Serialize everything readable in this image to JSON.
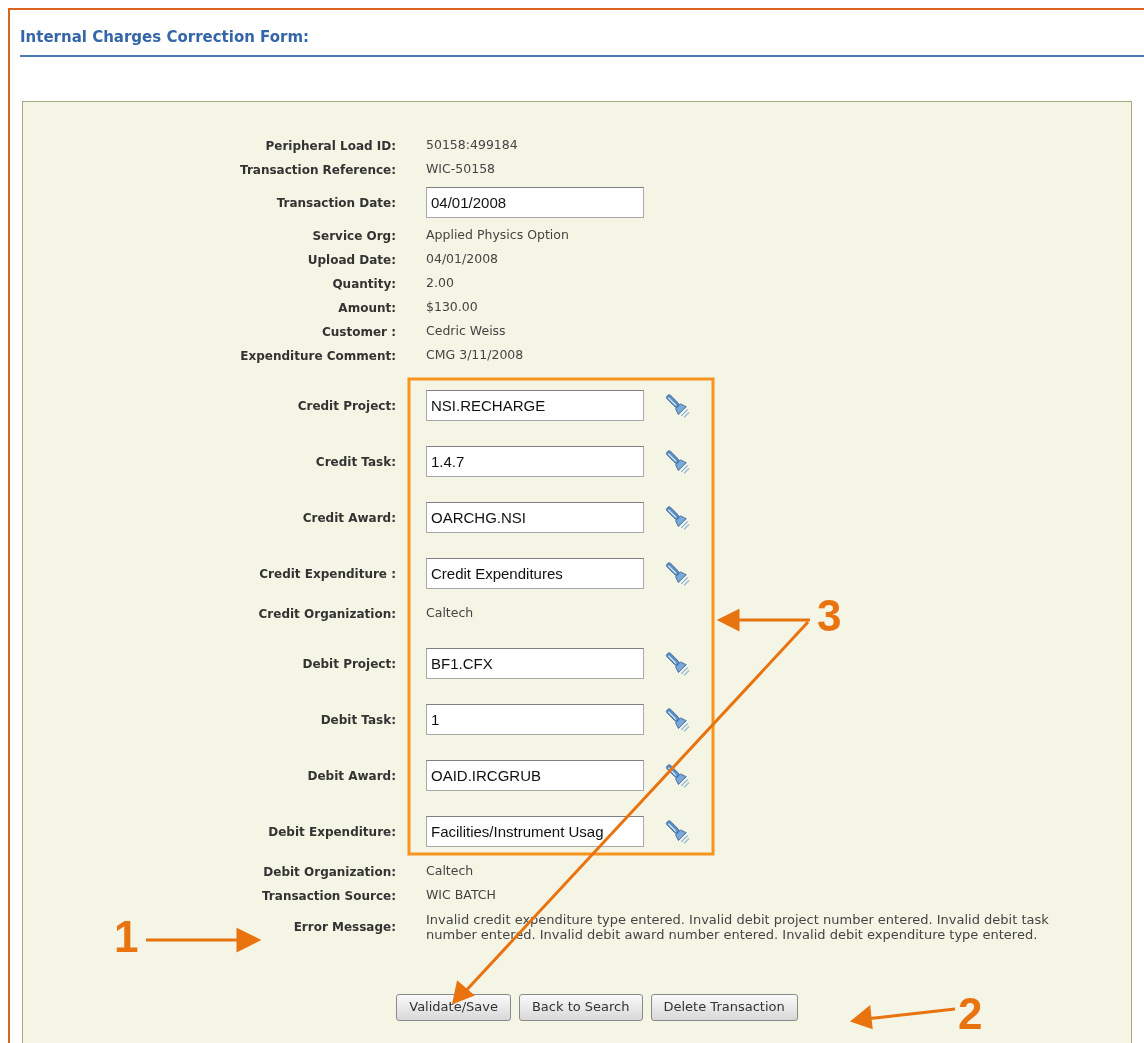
{
  "form": {
    "title": "Internal Charges Correction Form:"
  },
  "fields": [
    {
      "label": "Peripheral Load ID:",
      "kind": "text",
      "value": "50158:499184"
    },
    {
      "label": "Transaction Reference:",
      "kind": "text",
      "value": "WIC-50158"
    },
    {
      "label": "Transaction Date:",
      "kind": "input",
      "value": "04/01/2008"
    },
    {
      "label": "Service Org:",
      "kind": "text",
      "value": "Applied Physics Option"
    },
    {
      "label": "Upload Date:",
      "kind": "text",
      "value": "04/01/2008"
    },
    {
      "label": "Quantity:",
      "kind": "text",
      "value": "2.00"
    },
    {
      "label": "Amount:",
      "kind": "text",
      "value": "$130.00"
    },
    {
      "label": "Customer :",
      "kind": "text",
      "value": "Cedric Weiss"
    },
    {
      "label": "Expenditure Comment:",
      "kind": "text",
      "value": "CMG 3/11/2008"
    },
    {
      "label": "Credit Project:",
      "kind": "lookup",
      "value": "NSI.RECHARGE"
    },
    {
      "label": "Credit Task:",
      "kind": "lookup",
      "value": "1.4.7"
    },
    {
      "label": "Credit Award:",
      "kind": "lookup",
      "value": "OARCHG.NSI"
    },
    {
      "label": "Credit Expenditure :",
      "kind": "lookup",
      "value": "Credit Expenditures"
    },
    {
      "label": "Credit Organization:",
      "kind": "text",
      "value": "Caltech"
    },
    {
      "label": "Debit Project:",
      "kind": "lookup",
      "value": "BF1.CFX"
    },
    {
      "label": "Debit Task:",
      "kind": "lookup",
      "value": "1"
    },
    {
      "label": "Debit Award:",
      "kind": "lookup",
      "value": "OAID.IRCGRUB"
    },
    {
      "label": "Debit Expenditure:",
      "kind": "lookup",
      "value": "Facilities/Instrument Usag"
    },
    {
      "label": "Debit Organization:",
      "kind": "text",
      "value": "Caltech"
    },
    {
      "label": "Transaction Source:",
      "kind": "text",
      "value": "WIC BATCH"
    },
    {
      "label": "Error Message:",
      "kind": "error",
      "value": "Invalid credit expenditure type entered. Invalid debit project number entered. Invalid debit task number entered. Invalid debit award number entered. Invalid debit expenditure type entered."
    }
  ],
  "buttons": [
    "Validate/Save",
    "Back to Search",
    "Delete Transaction"
  ],
  "annotations": [
    {
      "number": "1"
    },
    {
      "number": "2"
    },
    {
      "number": "3"
    }
  ]
}
